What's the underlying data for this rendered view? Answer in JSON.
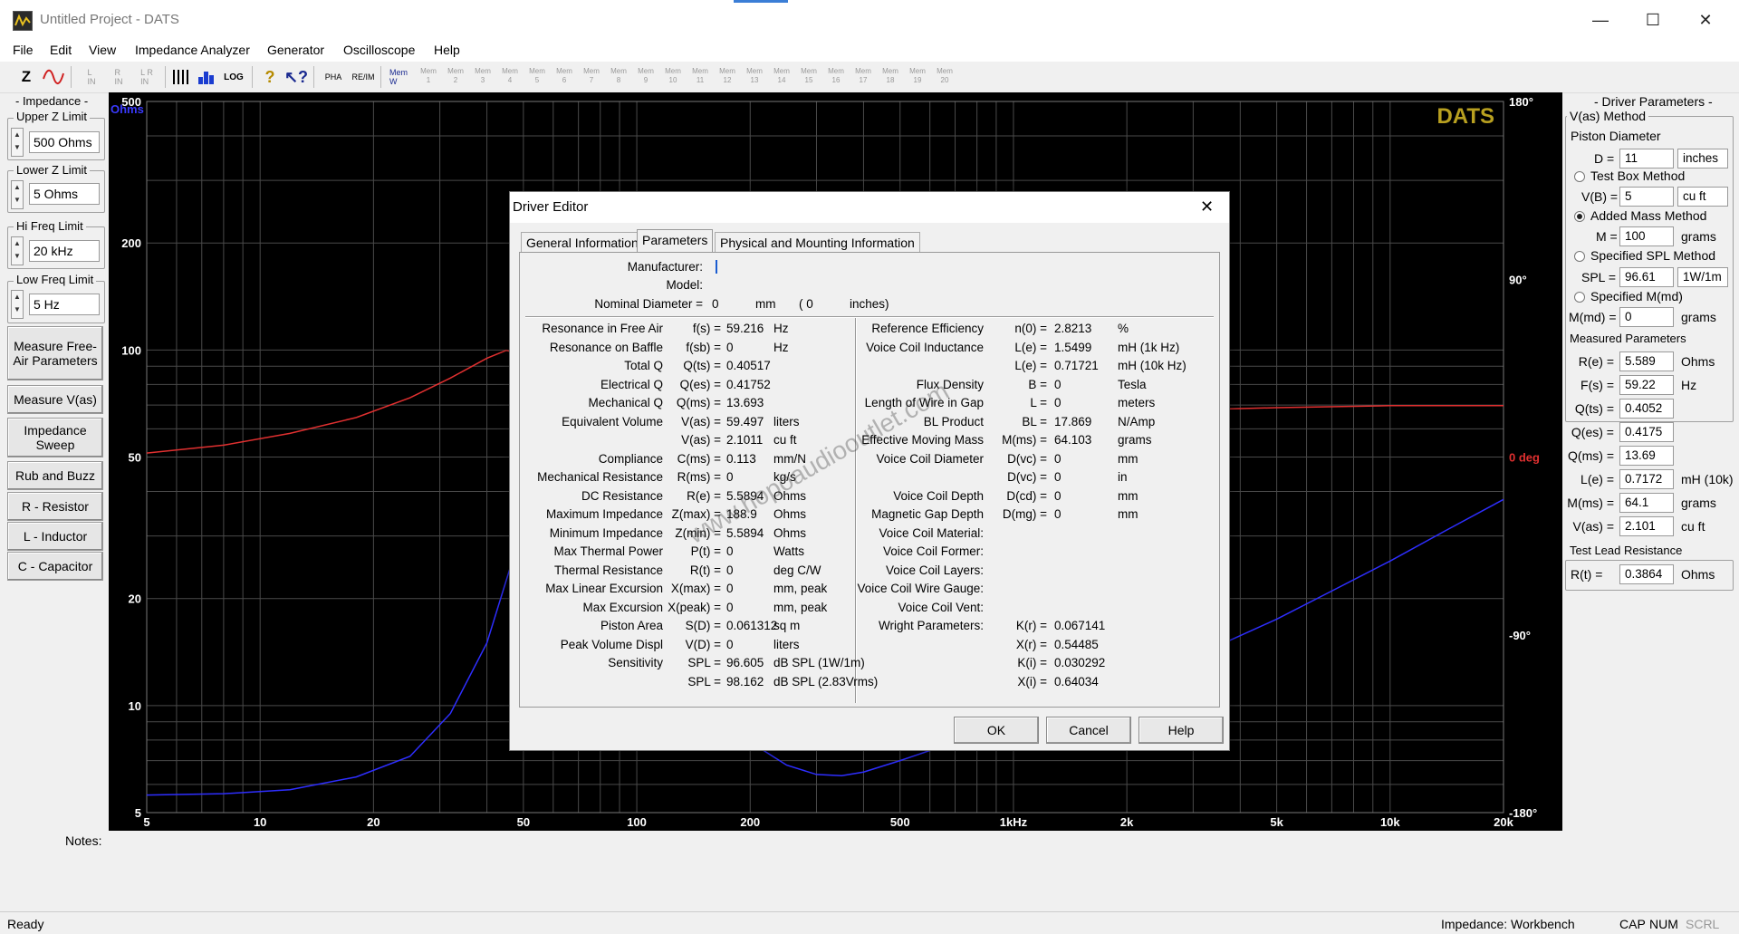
{
  "window": {
    "title": "Untitled Project - DATS",
    "minimize": "—",
    "maximize": "☐",
    "close": "✕"
  },
  "menu": [
    "File",
    "Edit",
    "View",
    "Impedance Analyzer",
    "Generator",
    "Oscilloscope",
    "Help"
  ],
  "toolbar": {
    "z": "Z",
    "l_in": "L\nIN",
    "r_in": "R\nIN",
    "lr_in": "L R\nIN",
    "log": "LOG",
    "pha": "PHA",
    "re_im": "RE/IM",
    "mem_w": "Mem\nW",
    "mem_slots": [
      "Mem\n1",
      "Mem\n2",
      "Mem\n3",
      "Mem\n4",
      "Mem\n5",
      "Mem\n6",
      "Mem\n7",
      "Mem\n8",
      "Mem\n9",
      "Mem\n10",
      "Mem\n11",
      "Mem\n12",
      "Mem\n13",
      "Mem\n14",
      "Mem\n15",
      "Mem\n16",
      "Mem\n17",
      "Mem\n18",
      "Mem\n19",
      "Mem\n20"
    ]
  },
  "left_panel": {
    "impedance_title": "- Impedance -",
    "upper_z_label": "Upper Z Limit",
    "upper_z_value": "500 Ohms",
    "lower_z_label": "Lower Z Limit",
    "lower_z_value": "5 Ohms",
    "hi_freq_label": "Hi Freq Limit",
    "hi_freq_value": "20 kHz",
    "low_freq_label": "Low Freq Limit",
    "low_freq_value": "5 Hz",
    "buttons": [
      "Measure Free-Air Parameters",
      "Measure V(as)",
      "Impedance Sweep",
      "Rub and Buzz",
      "R - Resistor",
      "L - Inductor",
      "C - Capacitor"
    ]
  },
  "chart_data": {
    "type": "line",
    "brand": "DATS",
    "y_unit": "Ohms",
    "y2_unit": "deg",
    "y_ticks": [
      "500",
      "200",
      "100",
      "50",
      "20",
      "10",
      "5"
    ],
    "y2_ticks": [
      "180°",
      "90°",
      "0 deg",
      "-90°",
      "-180°"
    ],
    "x_ticks": [
      "5",
      "10",
      "20",
      "50",
      "100",
      "200",
      "500",
      "1kHz",
      "2k",
      "5k",
      "10k",
      "20k"
    ],
    "xlim": [
      5,
      20000
    ],
    "ylim": [
      5,
      500
    ],
    "y2lim": [
      -180,
      180
    ],
    "x_scale": "log",
    "y_scale": "log",
    "grid": true,
    "colors": {
      "impedance": "#2e2eff",
      "phase": "#e03030",
      "grid": "#4a4a4a"
    },
    "series": [
      {
        "axis": "impedance",
        "x": [
          5,
          8,
          12,
          18,
          25,
          32,
          40,
          48,
          55,
          62,
          70,
          85,
          100,
          130,
          160,
          200,
          250,
          300,
          350,
          400,
          500,
          700,
          1000,
          1500,
          2000,
          3000,
          5000,
          7000,
          10000,
          14000,
          20000
        ],
        "y": [
          5.6,
          5.65,
          5.8,
          6.3,
          7.2,
          9.5,
          15,
          28,
          60,
          110,
          175,
          90,
          35,
          16,
          10.5,
          7.9,
          6.8,
          6.4,
          6.35,
          6.5,
          7.0,
          7.9,
          9.0,
          10.4,
          11.6,
          13.7,
          17.5,
          21,
          25.5,
          31,
          38
        ]
      },
      {
        "axis": "phase",
        "x": [
          5,
          8,
          12,
          18,
          25,
          32,
          40,
          45,
          50,
          55,
          60,
          65,
          70,
          80,
          100,
          150,
          200,
          300,
          500,
          1000,
          2000,
          5000,
          10000,
          20000
        ],
        "y": [
          2,
          6,
          12,
          20,
          30,
          40,
          50,
          54,
          52,
          40,
          15,
          -20,
          -30,
          -22,
          -12,
          -2,
          5,
          10,
          16,
          20,
          23,
          25,
          26,
          26
        ]
      }
    ]
  },
  "notes_label": "Notes:",
  "right_panel": {
    "title": "- Driver Parameters -",
    "vas_method": "V(as) Method",
    "piston_diameter": "Piston Diameter",
    "d_label": "D =",
    "d_value": "11",
    "d_unit": "inches",
    "test_box": "Test Box Method",
    "vb_label": "V(B) =",
    "vb_value": "5",
    "vb_unit": "cu ft",
    "added_mass": "Added Mass Method",
    "m_label": "M =",
    "m_value": "100",
    "m_unit": "grams",
    "specified_spl": "Specified SPL Method",
    "spl_label": "SPL =",
    "spl_value": "96.61",
    "spl_unit": "1W/1m",
    "specified_mmd": "Specified M(md)",
    "mmd_label": "M(md) =",
    "mmd_value": "0",
    "mmd_unit": "grams",
    "measured_title": "Measured Parameters",
    "measured": [
      {
        "label": "R(e) =",
        "value": "5.589",
        "unit": "Ohms"
      },
      {
        "label": "F(s) =",
        "value": "59.22",
        "unit": "Hz"
      },
      {
        "label": "Q(ts) =",
        "value": "0.4052",
        "unit": ""
      },
      {
        "label": "Q(es) =",
        "value": "0.4175",
        "unit": ""
      },
      {
        "label": "Q(ms) =",
        "value": "13.69",
        "unit": ""
      },
      {
        "label": "L(e) =",
        "value": "0.7172",
        "unit": "mH (10k)"
      },
      {
        "label": "M(ms) =",
        "value": "64.1",
        "unit": "grams"
      },
      {
        "label": "V(as) =",
        "value": "2.101",
        "unit": "cu ft"
      }
    ],
    "test_lead_title": "Test Lead Resistance",
    "rt_label": "R(t) =",
    "rt_value": "0.3864",
    "rt_unit": "Ohms"
  },
  "dialog": {
    "title": "Driver Editor",
    "close": "✕",
    "tabs": [
      "General Information",
      "Parameters",
      "Physical and Mounting Information"
    ],
    "manufacturer_label": "Manufacturer:",
    "model_label": "Model:",
    "nominal_label": "Nominal Diameter =",
    "nominal_value": "0",
    "nominal_unit": "mm",
    "nominal_in_open": "( 0",
    "nominal_in_unit": "inches)",
    "left_params": [
      {
        "name": "Resonance in Free Air",
        "sym": "f(s) =",
        "val": "59.216",
        "unit": "Hz"
      },
      {
        "name": "Resonance on Baffle",
        "sym": "f(sb) =",
        "val": "0",
        "unit": "Hz"
      },
      {
        "name": "Total Q",
        "sym": "Q(ts) =",
        "val": "0.40517",
        "unit": ""
      },
      {
        "name": "Electrical Q",
        "sym": "Q(es) =",
        "val": "0.41752",
        "unit": ""
      },
      {
        "name": "Mechanical Q",
        "sym": "Q(ms) =",
        "val": "13.693",
        "unit": ""
      },
      {
        "name": "Equivalent Volume",
        "sym": "V(as) =",
        "val": "59.497",
        "unit": "liters"
      },
      {
        "name": "",
        "sym": "V(as) =",
        "val": "2.1011",
        "unit": "cu ft"
      },
      {
        "name": "Compliance",
        "sym": "C(ms) =",
        "val": "0.113",
        "unit": "mm/N"
      },
      {
        "name": "Mechanical Resistance",
        "sym": "R(ms) =",
        "val": "0",
        "unit": "kg/s"
      },
      {
        "name": "DC Resistance",
        "sym": "R(e) =",
        "val": "5.5894",
        "unit": "Ohms"
      },
      {
        "name": "Maximum Impedance",
        "sym": "Z(max) =",
        "val": "188.9",
        "unit": "Ohms"
      },
      {
        "name": "Minimum Impedance",
        "sym": "Z(min) =",
        "val": "5.5894",
        "unit": "Ohms"
      },
      {
        "name": "Max Thermal Power",
        "sym": "P(t) =",
        "val": "0",
        "unit": "Watts"
      },
      {
        "name": "Thermal Resistance",
        "sym": "R(t) =",
        "val": "0",
        "unit": "deg C/W"
      },
      {
        "name": "Max Linear Excursion",
        "sym": "X(max) =",
        "val": "0",
        "unit": "mm, peak"
      },
      {
        "name": "Max Excursion",
        "sym": "X(peak) =",
        "val": "0",
        "unit": "mm, peak"
      },
      {
        "name": "Piston Area",
        "sym": "S(D) =",
        "val": "0.061312",
        "unit": "sq m"
      },
      {
        "name": "Peak Volume Displ",
        "sym": "V(D) =",
        "val": "0",
        "unit": "liters"
      },
      {
        "name": "Sensitivity",
        "sym": "SPL =",
        "val": "96.605",
        "unit": "dB SPL (1W/1m)"
      },
      {
        "name": "",
        "sym": "SPL =",
        "val": "98.162",
        "unit": "dB SPL (2.83Vrms)"
      }
    ],
    "right_params": [
      {
        "name": "Reference Efficiency",
        "sym": "n(0) =",
        "val": "2.8213",
        "unit": "%"
      },
      {
        "name": "Voice Coil Inductance",
        "sym": "L(e) =",
        "val": "1.5499",
        "unit": "mH (1k Hz)"
      },
      {
        "name": "",
        "sym": "L(e) =",
        "val": "0.71721",
        "unit": "mH (10k Hz)"
      },
      {
        "name": "Flux Density",
        "sym": "B =",
        "val": "0",
        "unit": "Tesla"
      },
      {
        "name": "Length of Wire in Gap",
        "sym": "L =",
        "val": "0",
        "unit": "meters"
      },
      {
        "name": "BL Product",
        "sym": "BL =",
        "val": "17.869",
        "unit": "N/Amp"
      },
      {
        "name": "Effective Moving Mass",
        "sym": "M(ms) =",
        "val": "64.103",
        "unit": "grams"
      },
      {
        "name": "Voice Coil Diameter",
        "sym": "D(vc) =",
        "val": "0",
        "unit": "mm"
      },
      {
        "name": "",
        "sym": "D(vc) =",
        "val": "0",
        "unit": "in"
      },
      {
        "name": "Voice Coil Depth",
        "sym": "D(cd) =",
        "val": "0",
        "unit": "mm"
      },
      {
        "name": "Magnetic Gap Depth",
        "sym": "D(mg) =",
        "val": "0",
        "unit": "mm"
      },
      {
        "name": "Voice Coil Material:",
        "sym": "",
        "val": "",
        "unit": ""
      },
      {
        "name": "Voice Coil Former:",
        "sym": "",
        "val": "",
        "unit": ""
      },
      {
        "name": "Voice Coil Layers:",
        "sym": "",
        "val": "",
        "unit": ""
      },
      {
        "name": "Voice Coil Wire Gauge:",
        "sym": "",
        "val": "",
        "unit": ""
      },
      {
        "name": "Voice Coil Vent:",
        "sym": "",
        "val": "",
        "unit": ""
      },
      {
        "name": "Wright Parameters:",
        "sym": "K(r) =",
        "val": "0.067141",
        "unit": ""
      },
      {
        "name": "",
        "sym": "X(r) =",
        "val": "0.54485",
        "unit": ""
      },
      {
        "name": "",
        "sym": "K(i) =",
        "val": "0.030292",
        "unit": ""
      },
      {
        "name": "",
        "sym": "X(i) =",
        "val": "0.64034",
        "unit": ""
      }
    ],
    "ok": "OK",
    "cancel": "Cancel",
    "help": "Help",
    "watermark": "www.hopoaudiooutlet.com"
  },
  "status": {
    "ready": "Ready",
    "mode": "Impedance: Workbench",
    "cap": "CAP",
    "num": "NUM",
    "scrl": "SCRL"
  }
}
